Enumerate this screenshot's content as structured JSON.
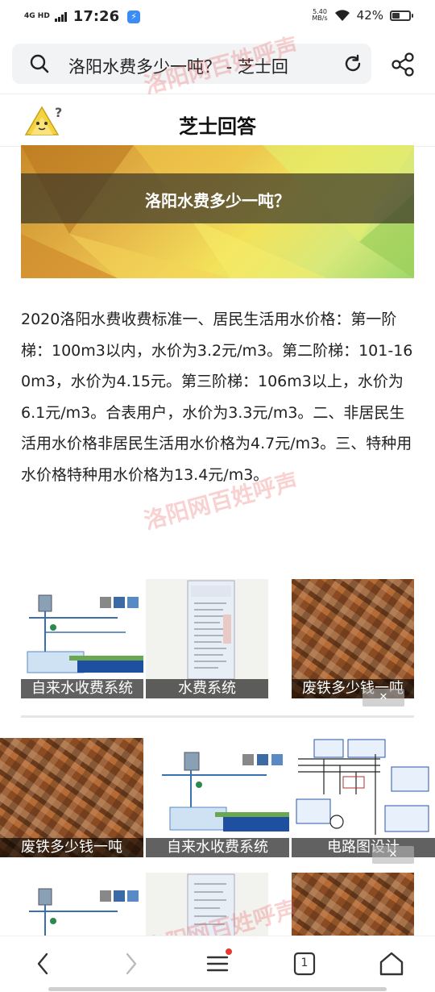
{
  "status_bar": {
    "network": "4G HD",
    "time": "17:26",
    "speed_value": "5.40",
    "speed_unit": "MB/s",
    "battery": "42%",
    "battery_level": 0.42
  },
  "address_bar": {
    "title": "洛阳水费多少一吨？ - 芝士回"
  },
  "site": {
    "name": "芝士回答"
  },
  "article": {
    "question": "洛阳水费多少一吨？",
    "answer": "2020洛阳水费收费标准一、居民生活用水价格：第一阶梯：100m3以内，水价为3.2元/m3。第二阶梯：101-160m3，水价为4.15元。第三阶梯：106m3以上，水价为6.1元/m3。合表用户，水价为3.3元/m3。二、非居民生活用水价格非居民生活用水价格为4.7元/m3。三、特种用水价格特种用水价格为13.4元/m3。"
  },
  "related": {
    "row1": [
      "自来水收费系统",
      "水费系统",
      "废铁多少钱一吨"
    ],
    "row2": [
      "废铁多少钱一吨",
      "自来水收费系统",
      "电路图设计"
    ]
  },
  "watermark": "洛阳网百姓呼声",
  "bottom_nav": {
    "tabs_count": "1"
  },
  "icons": [
    "search-icon",
    "reload-icon",
    "share-icon",
    "back-icon",
    "forward-icon",
    "menu-icon",
    "tabs-icon",
    "home-icon"
  ]
}
